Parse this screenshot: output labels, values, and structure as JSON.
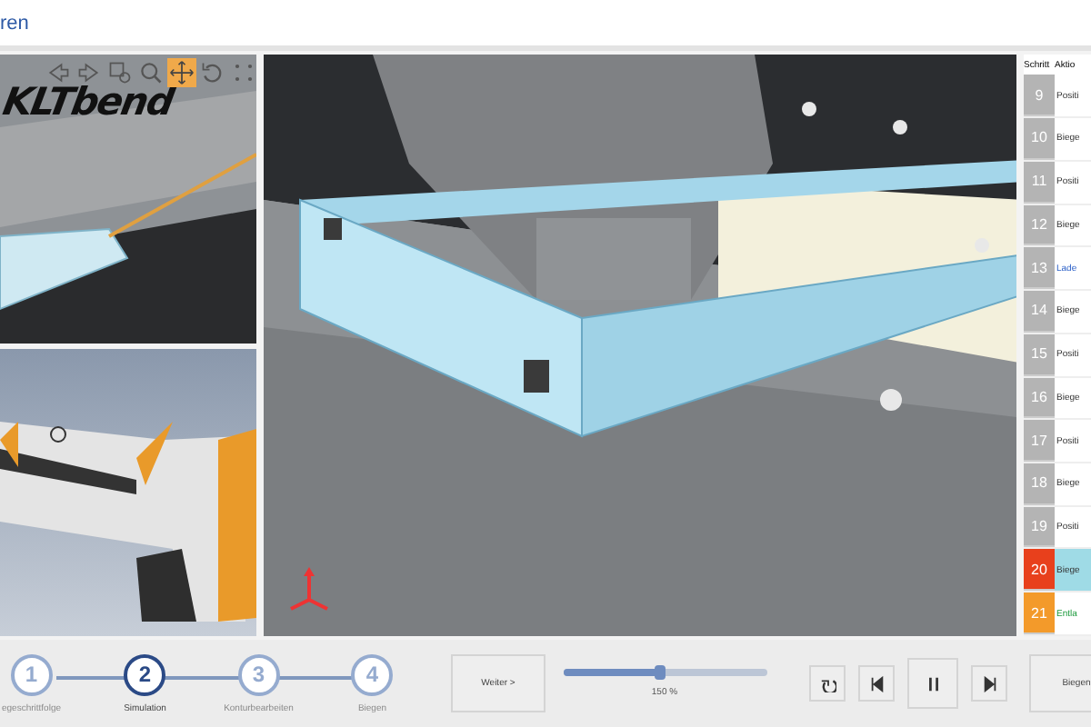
{
  "header": {
    "title": "ren"
  },
  "view_toolbar": [
    {
      "kind": "left",
      "selected": false
    },
    {
      "kind": "right",
      "selected": false
    },
    {
      "kind": "zoom-box",
      "selected": false
    },
    {
      "kind": "zoom",
      "selected": false
    },
    {
      "kind": "pan",
      "selected": true
    },
    {
      "kind": "rotate",
      "selected": false
    },
    {
      "kind": "grid",
      "selected": false
    }
  ],
  "machine_logo": "KLTbend",
  "step_table": {
    "columns": [
      "Schritt",
      "Aktio"
    ],
    "rows": [
      {
        "step": "9",
        "action": "Positi",
        "kind": "position",
        "color": "#b4b4b4",
        "selected": false
      },
      {
        "step": "10",
        "action": "Biege",
        "kind": "bend",
        "color": "#b4b4b4",
        "selected": false
      },
      {
        "step": "11",
        "action": "Positi",
        "kind": "position",
        "color": "#b4b4b4",
        "selected": false
      },
      {
        "step": "12",
        "action": "Biege",
        "kind": "bend",
        "color": "#b4b4b4",
        "selected": false
      },
      {
        "step": "13",
        "action": "Lade",
        "kind": "load",
        "color": "#b4b4b4",
        "selected": false
      },
      {
        "step": "14",
        "action": "Biege",
        "kind": "bend",
        "color": "#b4b4b4",
        "selected": false
      },
      {
        "step": "15",
        "action": "Positi",
        "kind": "position",
        "color": "#b4b4b4",
        "selected": false
      },
      {
        "step": "16",
        "action": "Biege",
        "kind": "bend",
        "color": "#b4b4b4",
        "selected": false
      },
      {
        "step": "17",
        "action": "Positi",
        "kind": "position",
        "color": "#b4b4b4",
        "selected": false
      },
      {
        "step": "18",
        "action": "Biege",
        "kind": "bend",
        "color": "#b4b4b4",
        "selected": false
      },
      {
        "step": "19",
        "action": "Positi",
        "kind": "position",
        "color": "#b4b4b4",
        "selected": false
      },
      {
        "step": "20",
        "action": "Biege",
        "kind": "bend",
        "color": "#e8401c",
        "selected": true
      },
      {
        "step": "21",
        "action": "Entla",
        "kind": "unload",
        "color": "#f39a2a",
        "selected": false
      }
    ]
  },
  "stepper": [
    {
      "number": "1",
      "label": "egeschrittfolge",
      "selected": false
    },
    {
      "number": "2",
      "label": "Simulation",
      "selected": true
    },
    {
      "number": "3",
      "label": "Konturbearbeiten",
      "selected": false
    },
    {
      "number": "4",
      "label": "Biegen",
      "selected": false
    }
  ],
  "next_button": "Weiter >",
  "speed": {
    "level": 0.48,
    "reading": "150 %"
  },
  "playback": [
    {
      "kind": "reset"
    },
    {
      "kind": "previous"
    },
    {
      "kind": "pause"
    },
    {
      "kind": "next"
    }
  ],
  "bend_button": "Biegen"
}
